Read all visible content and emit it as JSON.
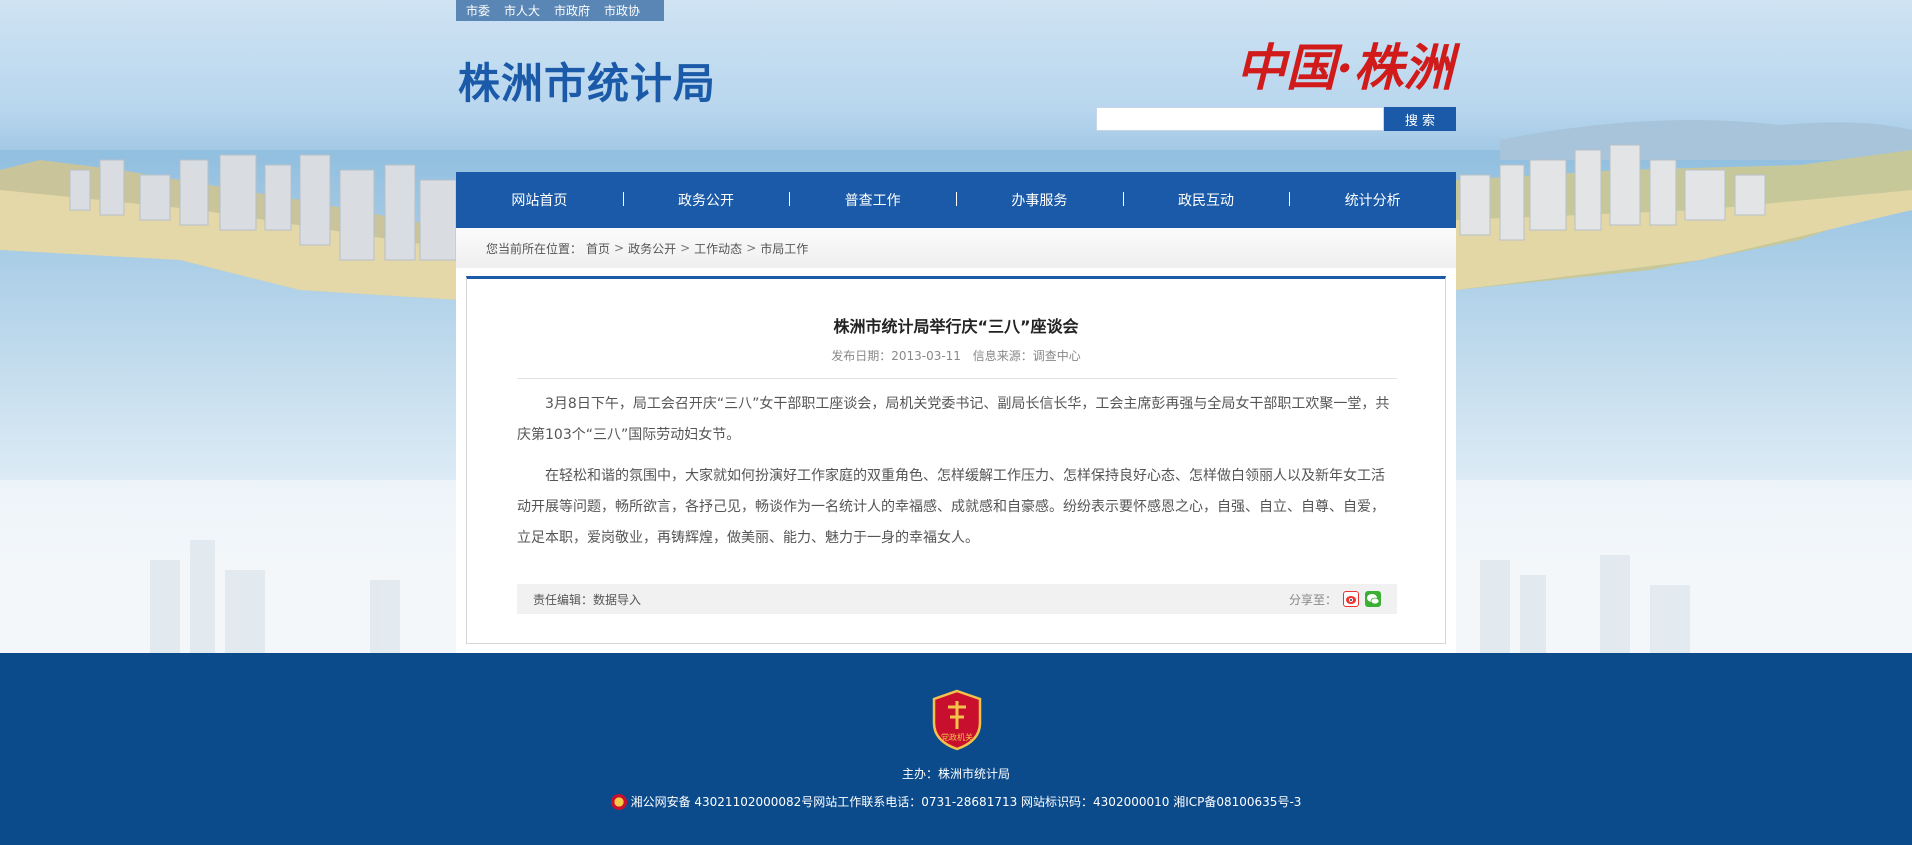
{
  "top_links": [
    "市委",
    "市人大",
    "市政府",
    "市政协"
  ],
  "site_title": "株洲市统计局",
  "brand_slogan": "中国·株洲",
  "search": {
    "placeholder": "",
    "button_label": "搜 索"
  },
  "nav": [
    "网站首页",
    "政务公开",
    "普查工作",
    "办事服务",
    "政民互动",
    "统计分析"
  ],
  "breadcrumb": {
    "label": "您当前所在位置：",
    "items": [
      "首页",
      "政务公开",
      "工作动态",
      "市局工作"
    ],
    "separator": ">"
  },
  "article": {
    "title": "株洲市统计局举行庆“三八”座谈会",
    "publish_label": "发布日期：2013-03-11",
    "source_label": "信息来源：调查中心",
    "paragraphs": [
      "3月8日下午，局工会召开庆“三八”女干部职工座谈会，局机关党委书记、副局长信长华，工会主席彭再强与全局女干部职工欢聚一堂，共庆第103个“三八”国际劳动妇女节。",
      "在轻松和谐的氛围中，大家就如何扮演好工作家庭的双重角色、怎样缓解工作压力、怎样保持良好心态、怎样做白领丽人以及新年女工活动开展等问题，畅所欲言，各抒己见，畅谈作为一名统计人的幸福感、成就感和自豪感。纷纷表示要怀感恩之心，自强、自立、自尊、自爱，立足本职，爱岗敬业，再铸辉煌，做美丽、能力、魅力于一身的幸福女人。"
    ],
    "editor_label": "责任编辑：数据导入",
    "share_label": "分享至："
  },
  "footer": {
    "emblem_text": "党政机关",
    "host": "主办：株洲市统计局",
    "info": "湘公网安备 43021102000082号网站工作联系电话：0731-28681713 网站标识码：4302000010 湘ICP备08100635号-3"
  },
  "colors": {
    "primary": "#1a5aa8",
    "footer": "#0b4b8c",
    "brand_red": "#d11a1a"
  }
}
